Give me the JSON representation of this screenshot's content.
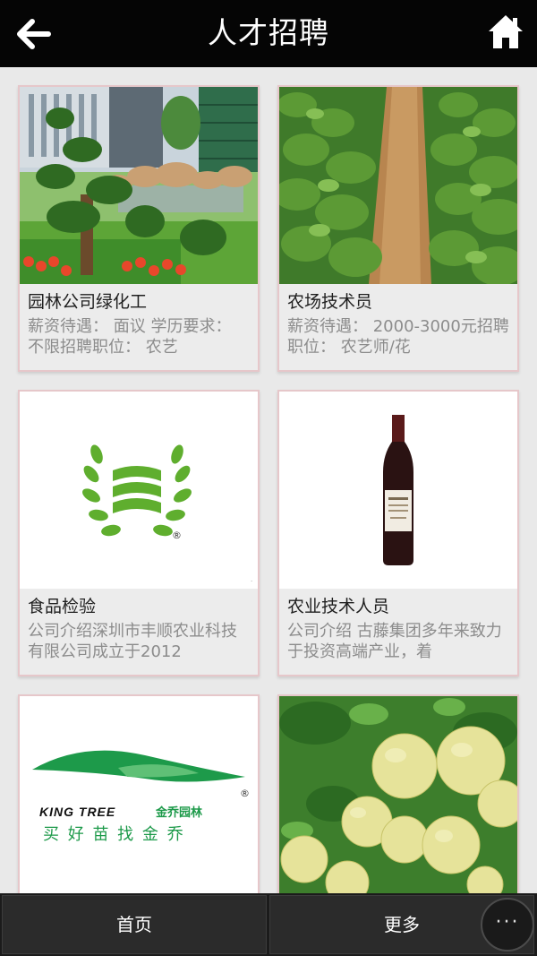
{
  "header": {
    "title": "人才招聘",
    "back_icon": "back-arrow-icon",
    "home_icon": "home-icon"
  },
  "jobs": [
    {
      "title": "园林公司绿化工",
      "desc": "薪资待遇： 面议 学历要求： 不限招聘职位： 农艺"
    },
    {
      "title": "农场技术员",
      "desc": "薪资待遇： 2000-3000元招聘职位： 农艺师/花"
    },
    {
      "title": "食品检验",
      "desc": "公司介绍深圳市丰顺农业科技有限公司成立于2012"
    },
    {
      "title": "农业技术人员",
      "desc": "公司介绍 古藤集团多年来致力于投资高端产业，着"
    },
    {
      "title": "",
      "desc": "",
      "logo_text_en": "KING TREE",
      "logo_text_cn_mark": "金乔园林",
      "logo_slogan": "买 好 苗 找 金 乔"
    },
    {
      "title": "",
      "desc": ""
    }
  ],
  "bottom_nav": {
    "home_label": "首页",
    "more_label": "更多",
    "menu_label": "···"
  },
  "colors": {
    "header_bg": "#050505",
    "card_border": "#e6c7ca",
    "info_bg": "#ececec",
    "accent_green": "#2a9a46"
  }
}
